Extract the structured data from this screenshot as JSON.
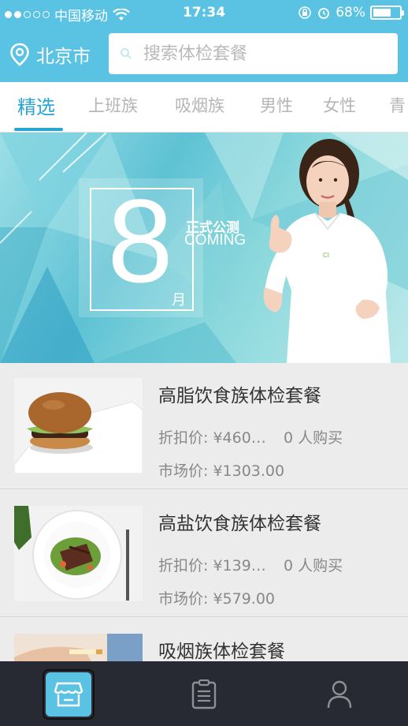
{
  "status_bar": {
    "carrier": "中国移动",
    "time": "17:34",
    "battery": "68%",
    "battery_level": 0.68
  },
  "header": {
    "city": "北京市",
    "location_icon": "location-pin-icon",
    "search_placeholder": "搜索体检套餐",
    "search_value": ""
  },
  "tabs": [
    {
      "label": "精选",
      "active": true
    },
    {
      "label": "上班族"
    },
    {
      "label": "吸烟族"
    },
    {
      "label": "男性"
    },
    {
      "label": "女性"
    },
    {
      "label": "青"
    }
  ],
  "banner": {
    "number": "8",
    "unit": "月",
    "label_cn": "正式公测",
    "label_en": "COMING"
  },
  "packages": [
    {
      "title": "高脂饮食族体检套餐",
      "discount": "折扣价: ¥460…",
      "buyers": "0 人购买",
      "market": "市场价: ¥1303.00",
      "image": "burger"
    },
    {
      "title": "高盐饮食族体检套餐",
      "discount": "折扣价: ¥139…",
      "buyers": "0 人购买",
      "market": "市场价: ¥579.00",
      "image": "steak-salad"
    },
    {
      "title": "吸烟族体检套餐",
      "image": "hand-cigarette"
    }
  ],
  "tabbar": [
    {
      "icon": "store-icon",
      "active": true
    },
    {
      "icon": "clipboard-icon"
    },
    {
      "icon": "user-icon"
    }
  ],
  "colors": {
    "accent": "#5ac3e4",
    "active_tab": "#27a6d4",
    "tabbar": "#272a33"
  }
}
